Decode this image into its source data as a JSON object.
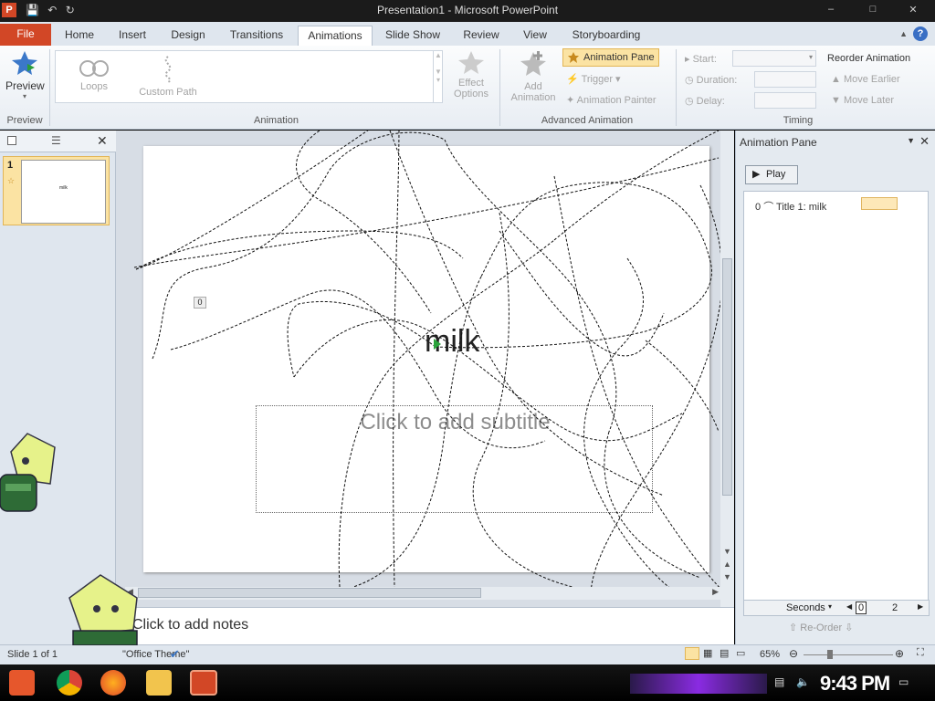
{
  "window": {
    "title": "Presentation1 - Microsoft PowerPoint",
    "app_logo": "P",
    "minimize": "–",
    "maximize": "□",
    "close": "✕"
  },
  "qat": {
    "save_icon": "💾",
    "undo_icon": "↶",
    "redo_icon": "↻"
  },
  "tabs": {
    "file": "File",
    "home": "Home",
    "insert": "Insert",
    "design": "Design",
    "transitions": "Transitions",
    "animations": "Animations",
    "slideshow": "Slide Show",
    "review": "Review",
    "view": "View",
    "storyboarding": "Storyboarding",
    "help": "?"
  },
  "ribbon": {
    "preview": {
      "button": "Preview",
      "group": "Preview"
    },
    "animation": {
      "group": "Animation",
      "loops": "Loops",
      "custom_path": "Custom Path",
      "effect_options_1": "Effect",
      "effect_options_2": "Options"
    },
    "advanced": {
      "group": "Advanced Animation",
      "add_animation_1": "Add",
      "add_animation_2": "Animation",
      "animation_pane": "Animation Pane",
      "trigger": "Trigger",
      "animation_painter": "Animation Painter"
    },
    "timing": {
      "group": "Timing",
      "start": "Start:",
      "duration": "Duration:",
      "delay": "Delay:",
      "reorder_title": "Reorder Animation",
      "move_earlier": "Move Earlier",
      "move_later": "Move Later"
    }
  },
  "slides_panel": {
    "slide_number": "1",
    "thumb_text": "milk"
  },
  "slide": {
    "title": "milk",
    "subtitle_placeholder": "Click to add subtitle",
    "anim_tag": "0"
  },
  "notes": {
    "placeholder": "Click to add notes"
  },
  "anim_pane": {
    "title": "Animation Pane",
    "play": "Play",
    "items": [
      {
        "index": "0",
        "label": "Title 1: milk"
      }
    ],
    "seconds": "Seconds",
    "scale_start": "0",
    "scale_end": "2",
    "reorder": "Re-Order"
  },
  "status": {
    "slide_info": "Slide 1 of 1",
    "theme": "\"Office Theme\"",
    "zoom": "65%"
  },
  "taskbar": {
    "clock": "9:43 PM"
  }
}
